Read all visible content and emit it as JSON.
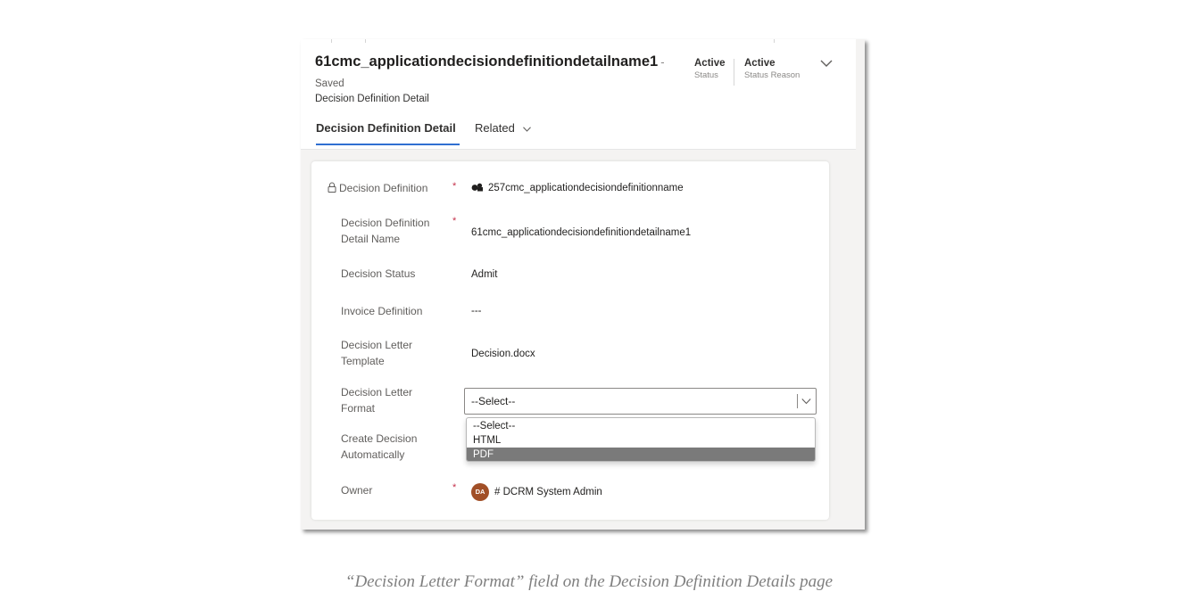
{
  "header": {
    "record_title": "61cmc_applicationdecisiondefinitiondetailname1",
    "title_dash": "-",
    "save_state": "Saved",
    "entity_name": "Decision Definition Detail",
    "status": {
      "value": "Active",
      "label": "Status"
    },
    "status_reason": {
      "value": "Active",
      "label": "Status Reason"
    }
  },
  "tabs": {
    "main": "Decision Definition Detail",
    "related": "Related"
  },
  "form": {
    "decision_definition": {
      "label": "Decision Definition",
      "required": "*",
      "value": "257cmc_applicationdecisiondefinitionname"
    },
    "detail_name": {
      "label": "Decision Definition Detail Name",
      "required": "*",
      "value": "61cmc_applicationdecisiondefinitiondetailname1"
    },
    "decision_status": {
      "label": "Decision Status",
      "value": "Admit"
    },
    "invoice_definition": {
      "label": "Invoice Definition",
      "value": "---"
    },
    "letter_template": {
      "label": "Decision Letter Template",
      "value": "Decision.docx"
    },
    "letter_format": {
      "label": "Decision Letter Format",
      "selected": "--Select--",
      "options": [
        "--Select--",
        "HTML",
        "PDF"
      ],
      "highlighted_option": "PDF"
    },
    "create_auto": {
      "label": "Create Decision Automatically"
    },
    "owner": {
      "label": "Owner",
      "required": "*",
      "initials": "DA",
      "value": "# DCRM System Admin"
    }
  },
  "caption": "“Decision Letter Format” field on the Decision Definition Details page",
  "colors": {
    "accent": "#2f6fd1",
    "required": "#c4314b",
    "avatar": "#a14f27",
    "highlight": "#7a7a7a"
  },
  "icons": [
    "lock-icon",
    "lookup-entity-icon",
    "chevron-down-icon"
  ]
}
